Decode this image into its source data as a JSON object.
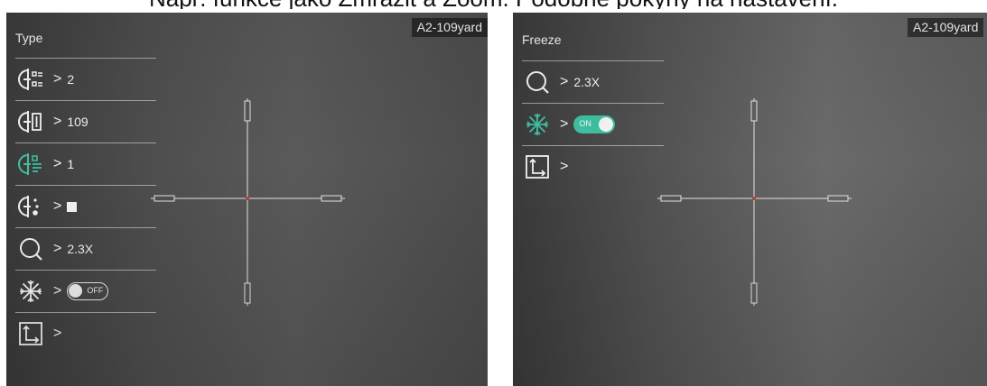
{
  "caption": "Např. funkce jako Zmrazit a Zoom. Podobně pokyny na nastavení.",
  "left_screen": {
    "title": "Type",
    "profile": "A2-109yard",
    "menu": [
      {
        "icon": "reticle-type-icon",
        "value": "2"
      },
      {
        "icon": "reticle-size-icon",
        "value": "109"
      },
      {
        "icon": "reticle-style-icon",
        "value": "1"
      },
      {
        "icon": "reticle-color-icon",
        "value": "white-square"
      },
      {
        "icon": "zoom-icon",
        "value": "2.3X"
      },
      {
        "icon": "freeze-icon",
        "value": "OFF"
      },
      {
        "icon": "position-icon",
        "value": ""
      }
    ],
    "arrow": ">"
  },
  "right_screen": {
    "title": "Freeze",
    "profile": "A2-109yard",
    "menu": [
      {
        "icon": "zoom-icon",
        "value": "2.3X"
      },
      {
        "icon": "freeze-icon",
        "value": "ON"
      },
      {
        "icon": "position-icon",
        "value": ""
      }
    ],
    "arrow": ">"
  },
  "colors": {
    "accent": "#3ec0a2",
    "text": "#f2f2f2",
    "center_dot": "#c0392b"
  }
}
